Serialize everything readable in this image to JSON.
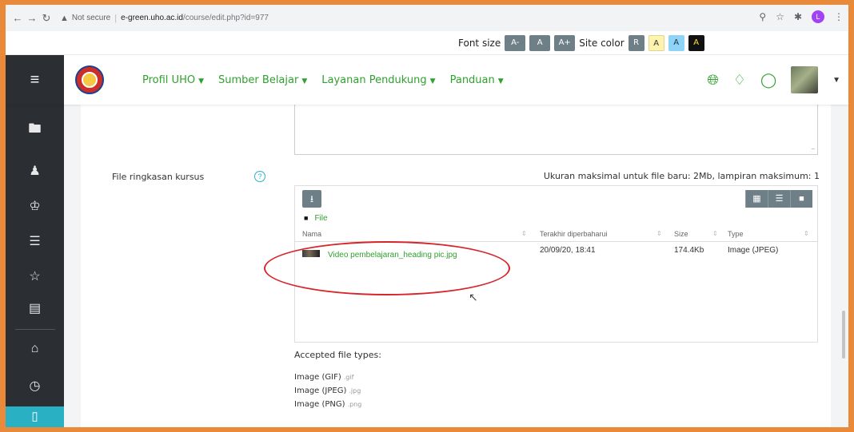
{
  "browser": {
    "warning": "▲",
    "not_secure": "Not secure",
    "host": "e-green.uho.ac.id",
    "path": "/course/edit.php?id=977",
    "profile_initial": "L"
  },
  "a11y": {
    "font_size_label": "Font size",
    "font_buttons": [
      "A-",
      "A",
      "A+"
    ],
    "site_color_label": "Site color",
    "color_buttons": [
      "R",
      "A",
      "A",
      "A"
    ]
  },
  "nav": {
    "menu": [
      {
        "label": "Profil UHO"
      },
      {
        "label": "Sumber Belajar"
      },
      {
        "label": "Layanan Pendukung"
      },
      {
        "label": "Panduan"
      }
    ]
  },
  "form": {
    "field_label": "File ringkasan kursus",
    "limit_text": "Ukuran maksimal untuk file baru: 2Mb, lampiran maksimum: 1",
    "folder": "File",
    "columns": {
      "name": "Nama",
      "modified": "Terakhir diperbaharui",
      "size": "Size",
      "type": "Type"
    },
    "file": {
      "name": "Video pembelajaran_heading pic.jpg",
      "modified": "20/09/20, 18:41",
      "size": "174.4Kb",
      "type": "Image (JPEG)"
    },
    "accepted_label": "Accepted file types:",
    "accepted_types": [
      {
        "name": "Image (GIF)",
        "ext": ".gif"
      },
      {
        "name": "Image (JPEG)",
        "ext": ".jpg"
      },
      {
        "name": "Image (PNG)",
        "ext": ".png"
      }
    ]
  },
  "colors": {
    "accent_green": "#2fa12f",
    "sidebar": "#2b2f33",
    "annotation_red": "#d7262b",
    "border": "#e98a3a"
  }
}
